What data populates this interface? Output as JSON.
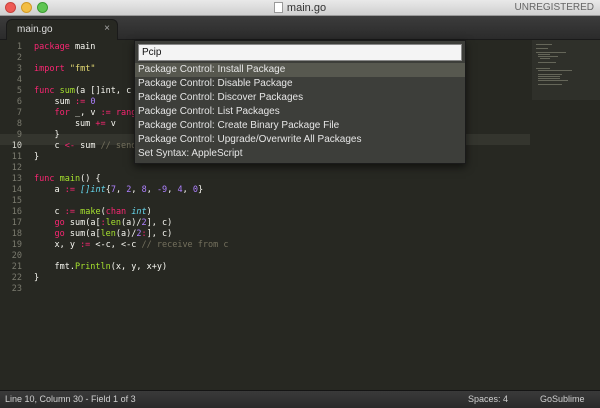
{
  "window": {
    "title": "main.go",
    "registration": "UNREGISTERED"
  },
  "tabs": [
    {
      "label": "main.go",
      "close": "×"
    }
  ],
  "editor": {
    "line_numbers": [
      "1",
      "2",
      "3",
      "4",
      "5",
      "6",
      "7",
      "8",
      "9",
      "10",
      "11",
      "12",
      "13",
      "14",
      "15",
      "16",
      "17",
      "18",
      "19",
      "20",
      "21",
      "22",
      "23"
    ],
    "current_line": 10,
    "code": {
      "l1_kw": "package",
      "l1_rest": " main",
      "l3_kw": "import",
      "l3_str": "\"fmt\"",
      "l5_kw": "func",
      "l5_fn": "sum",
      "l5_rest": "(a []int, c ",
      "l6_pre": "    sum ",
      "l6_op": ":=",
      "l6_num": "0",
      "l7_kw": "for",
      "l7_mid": " _, v ",
      "l7_op": ":=",
      "l7_kw2": "range",
      "l8_pre": "        sum ",
      "l8_op": "+=",
      "l8_rest": " v",
      "l9_text": "    }",
      "l10_pre": "    c ",
      "l10_op": "<-",
      "l10_mid": " sum ",
      "l10_cmt": "// send",
      "l11_text": "}",
      "l13_kw": "func",
      "l13_fn": "main",
      "l13_rest": "() {",
      "l14_pre": "    a ",
      "l14_op": ":=",
      "l14_typ": "[]int",
      "l14_open": "{",
      "l14_n1": "7",
      "l14_n2": "2",
      "l14_n3": "8",
      "l14_n4": "-9",
      "l14_n5": "4",
      "l14_n6": "0",
      "l14_close": "}",
      "l16_pre": "    c ",
      "l16_op": ":=",
      "l16_fn": "make",
      "l16_open": "(",
      "l16_kw": "chan",
      "l16_typ": "int",
      "l16_close": ")",
      "l17_kw": "go",
      "l17_rest1": " sum(a[",
      "l17_colon": ":",
      "l17_fn": "len",
      "l17_rest2": "(a)/",
      "l17_num": "2",
      "l17_rest3": "], c)",
      "l18_kw": "go",
      "l18_rest1": " sum(a[",
      "l18_fn": "len",
      "l18_rest2": "(a)/",
      "l18_num": "2",
      "l18_colon": ":",
      "l18_rest3": "], c)",
      "l19_pre": "    x, y ",
      "l19_op": ":=",
      "l19_a": " <-c, <-c ",
      "l19_cmt": "// receive from c",
      "l21_pre": "    fmt.",
      "l21_fn": "Println",
      "l21_rest": "(x, y, x+y)",
      "l22_text": "}"
    }
  },
  "command_palette": {
    "query": "Pcip",
    "items": [
      "Package Control: Install Package",
      "Package Control: Disable Package",
      "Package Control: Discover Packages",
      "Package Control: List Packages",
      "Package Control: Create Binary Package File",
      "Package Control: Upgrade/Overwrite All Packages",
      "Set Syntax: AppleScript"
    ],
    "selected_index": 0
  },
  "status_bar": {
    "position": "Line 10, Column 30 - Field 1 of 3",
    "indentation": "Spaces: 4",
    "plugin": "GoSublime"
  },
  "colors": {
    "background": "#272822",
    "keyword": "#f92672",
    "string": "#e6db74",
    "function": "#a6e22e",
    "number": "#ae81ff",
    "type": "#66d9ef",
    "comment": "#75715e"
  }
}
